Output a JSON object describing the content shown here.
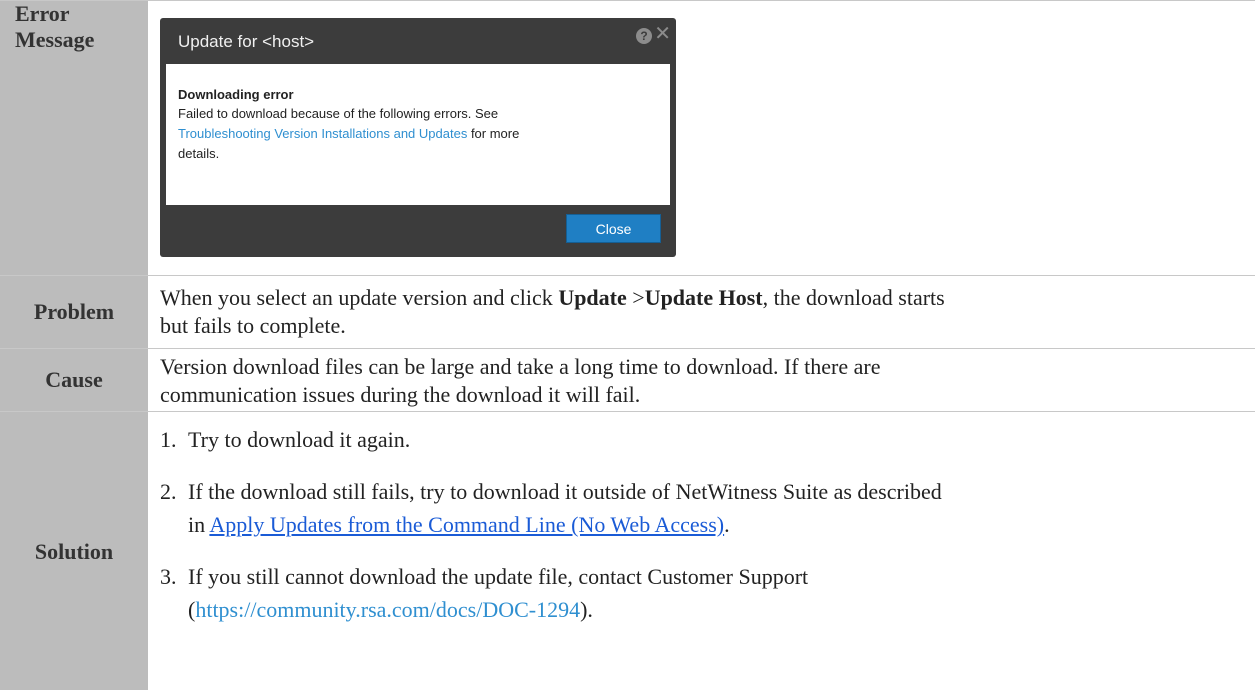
{
  "rows": {
    "error_message": {
      "label_line1": "Error",
      "label_line2": "Message",
      "dialog": {
        "title": "Update for <host>",
        "help_icon": "?",
        "close_icon": "✕",
        "heading": "Downloading error",
        "message_part1": "Failed to download because of the following errors. See",
        "message_link": "Troubleshooting Version Installations and Updates",
        "message_part2": " for more",
        "message_part3": "details.",
        "close_button": "Close"
      }
    },
    "problem": {
      "label": "Problem",
      "text_1": "When you select an update version and click ",
      "bold_1": "Update",
      "text_2": " >",
      "bold_2": "Update Host",
      "text_3": ", the download starts",
      "text_4": "but fails to complete."
    },
    "cause": {
      "label": "Cause",
      "line1": "Version download files can be large and take a long time to download. If there are",
      "line2": "communication issues during the download it will fail."
    },
    "solution": {
      "label": "Solution",
      "steps": [
        {
          "num": "1.",
          "line1": "Try to download it again."
        },
        {
          "num": "2.",
          "line1": "If the download still fails, try to download it outside of NetWitness Suite as described",
          "line2_prefix": "in ",
          "link": "Apply Updates from the Command Line (No Web Access)",
          "line2_suffix": "."
        },
        {
          "num": "3.",
          "line1": "If you still cannot download the update file, contact Customer Support",
          "line2_prefix": "(",
          "link": "https://community.rsa.com/docs/DOC-1294",
          "line2_suffix": ")."
        }
      ]
    }
  },
  "colors": {
    "label_bg": "#bcbcbc",
    "dialog_bg": "#3c3c3c",
    "button_bg": "#1f7fc4",
    "link": "#1a5bd6"
  }
}
